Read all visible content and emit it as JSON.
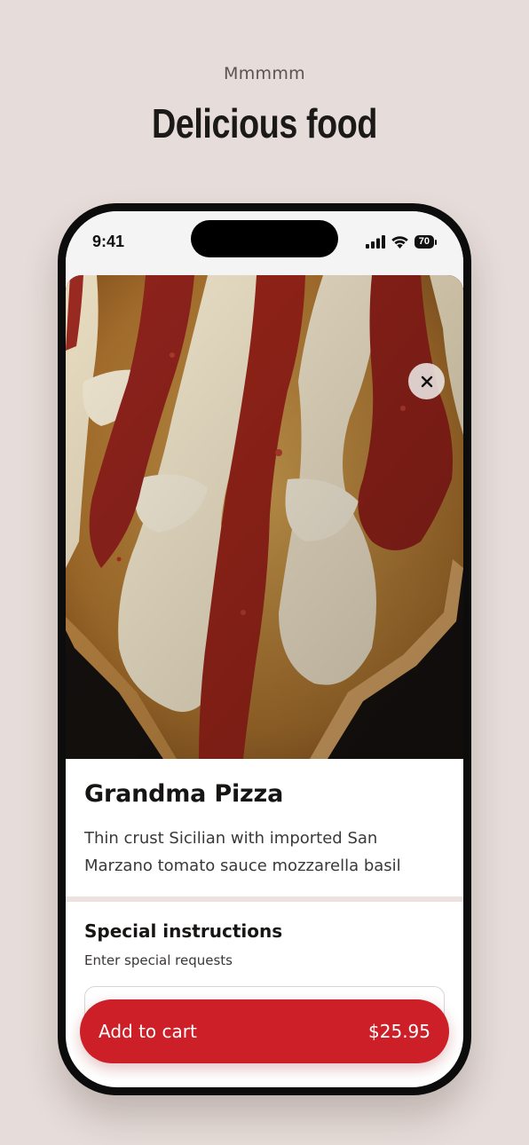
{
  "header": {
    "eyebrow": "Mmmmm",
    "headline": "Delicious food"
  },
  "status_bar": {
    "time": "9:41",
    "battery": "70"
  },
  "item": {
    "title": "Grandma Pizza",
    "description": "Thin crust Sicilian with imported San Marzano tomato sauce mozzarella basil"
  },
  "instructions": {
    "title": "Special instructions",
    "hint": "Enter special requests",
    "value": ""
  },
  "cart": {
    "label": "Add to cart",
    "price": "$25.95"
  },
  "colors": {
    "background": "#e6dcd9",
    "accent": "#cc1f27"
  },
  "icons": {
    "close": "close-icon",
    "signal": "cellular-signal-icon",
    "wifi": "wifi-icon",
    "battery": "battery-icon"
  }
}
